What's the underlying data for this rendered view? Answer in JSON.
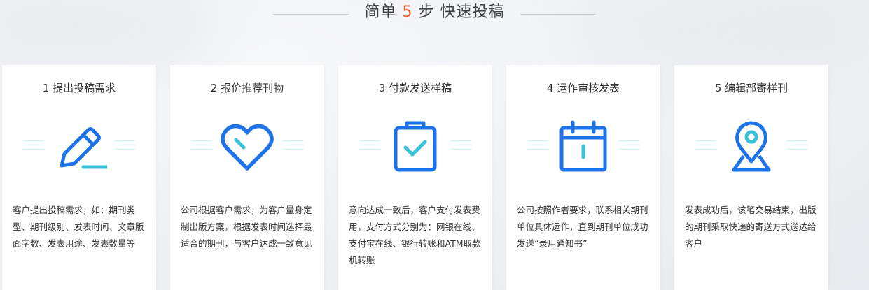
{
  "header": {
    "prefix": "简单",
    "number": "5",
    "suffix": "步 快速投稿"
  },
  "colors": {
    "accent_blue": "#1e73e8",
    "accent_cyan": "#37c2d8",
    "highlight_orange": "#f05a28"
  },
  "steps": [
    {
      "title": "1 提出投稿需求",
      "icon": "pencil-icon",
      "desc": "客户提出投稿需求，如：期刊类型、期刊级别、发表时间、文章版面字数、发表用途、发表数量等"
    },
    {
      "title": "2 报价推荐刊物",
      "icon": "heart-icon",
      "desc": "公司根据客户需求，为客户量身定制出版方案，根据发表时间选择最适合的期刊，与客户达成一致意见"
    },
    {
      "title": "3 付款发送样稿",
      "icon": "clipboard-check-icon",
      "desc": "意向达成一致后，客户支付发表费用，支付方式分别为：网银在线、支付宝在线、银行转账和ATM取款机转账"
    },
    {
      "title": "4 运作审核发表",
      "icon": "calendar-icon",
      "desc": "公司按照作者要求，联系相关期刊单位具体运作，直到期刊单位成功发送“录用通知书”"
    },
    {
      "title": "5 编辑部寄样刊",
      "icon": "location-pin-icon",
      "desc": "发表成功后，该笔交易结束，出版的期刊采取快递的寄送方式送达给客户"
    }
  ]
}
